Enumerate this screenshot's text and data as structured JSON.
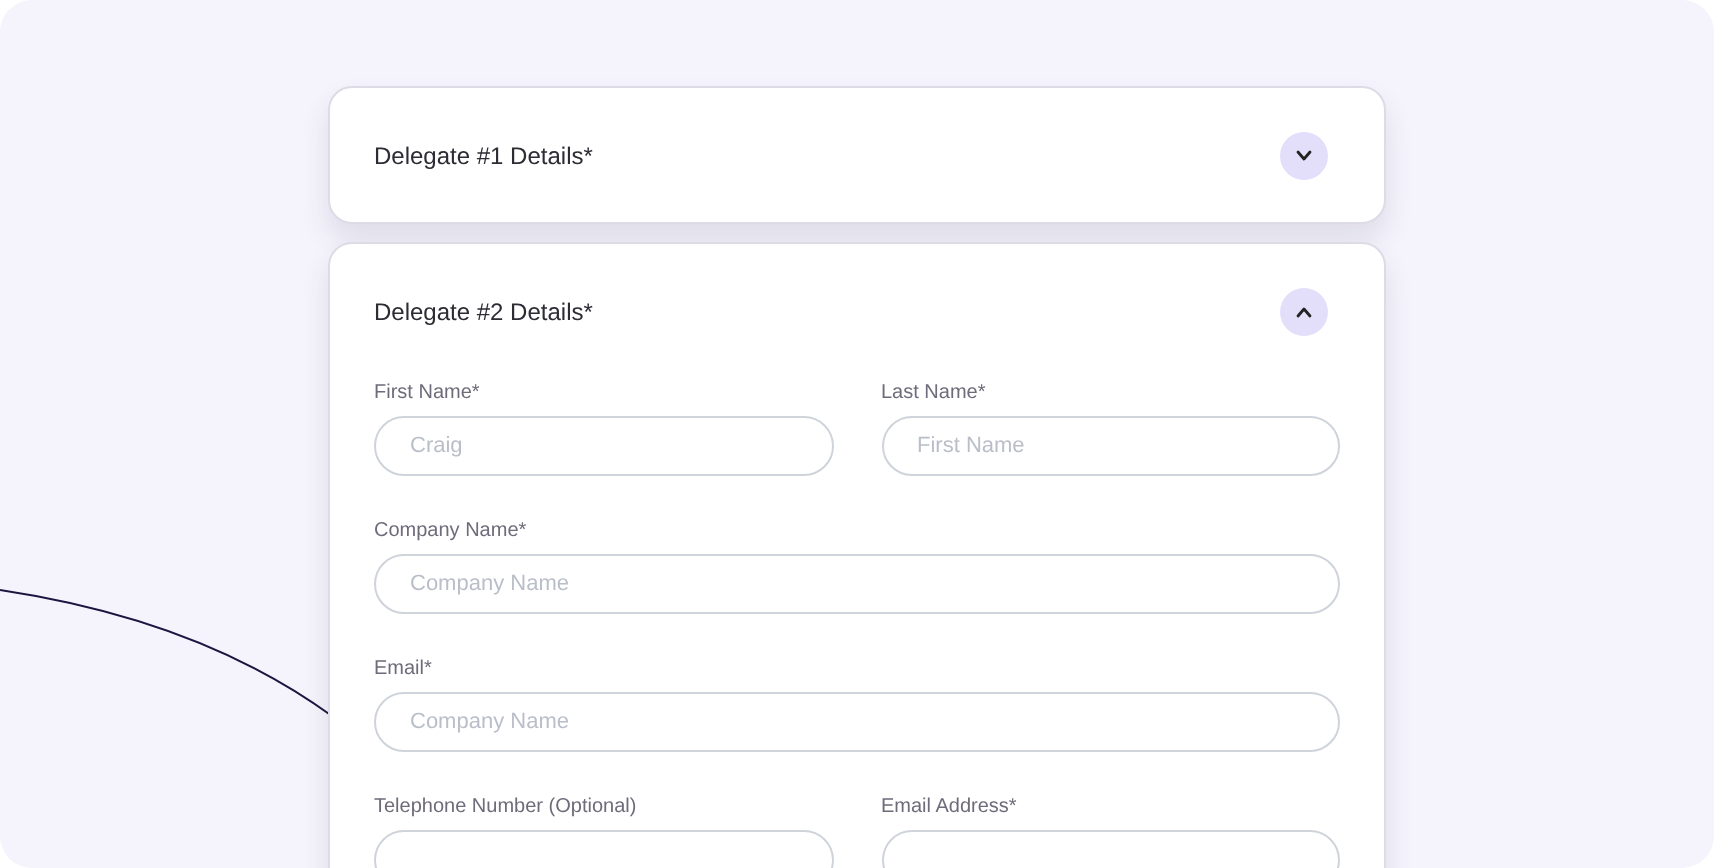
{
  "delegates": [
    {
      "title": "Delegate #1 Details*",
      "expanded": false
    },
    {
      "title": "Delegate #2 Details*",
      "expanded": true,
      "field_rows": [
        [
          {
            "label": "First Name*",
            "placeholder": "Craig"
          },
          {
            "label": "Last Name*",
            "placeholder": "First Name"
          }
        ],
        [
          {
            "label": "Company Name*",
            "placeholder": "Company Name"
          }
        ],
        [
          {
            "label": "Email*",
            "placeholder": "Company Name"
          }
        ],
        [
          {
            "label": "Telephone Number (Optional)"
          },
          {
            "label": "Email Address*"
          }
        ]
      ]
    }
  ]
}
